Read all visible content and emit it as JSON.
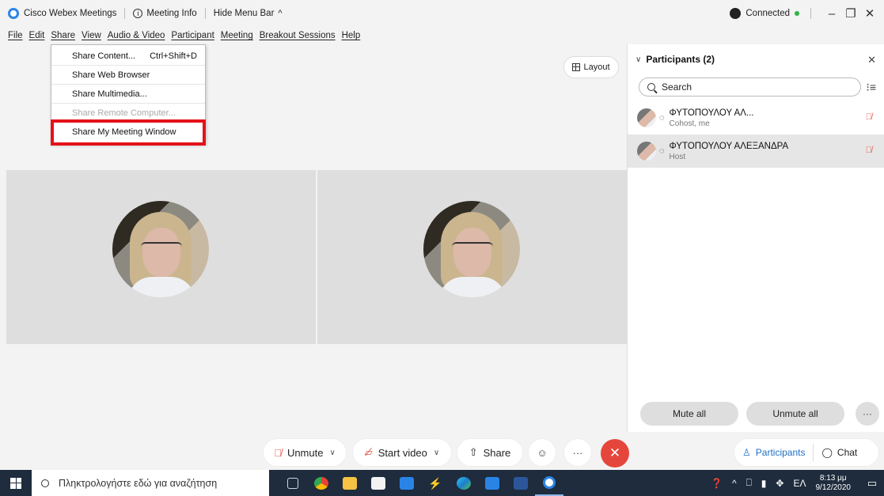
{
  "titlebar": {
    "app_name": "Cisco Webex Meetings",
    "meeting_info": "Meeting Info",
    "hide_menu": "Hide Menu Bar",
    "connection_status": "Connected"
  },
  "menubar": {
    "items": [
      "File",
      "Edit",
      "Share",
      "View",
      "Audio & Video",
      "Participant",
      "Meeting",
      "Breakout Sessions",
      "Help"
    ]
  },
  "share_menu": {
    "items": [
      {
        "label": "Share Content...",
        "shortcut": "Ctrl+Shift+D",
        "enabled": true
      },
      {
        "label": "Share Web Browser",
        "shortcut": "",
        "enabled": true
      },
      {
        "label": "Share Multimedia...",
        "shortcut": "",
        "enabled": true
      },
      {
        "label": "Share Remote Computer...",
        "shortcut": "",
        "enabled": false
      },
      {
        "label": "Share My Meeting Window",
        "shortcut": "",
        "enabled": true
      }
    ],
    "highlight_color": "#e51219"
  },
  "main": {
    "layout_label": "Layout"
  },
  "participants_panel": {
    "title": "Participants (2)",
    "search_placeholder": "Search",
    "participants": [
      {
        "name": "ΦΥΤΟΠΟΥΛΟΥ ΑΛ...",
        "role": "Cohost, me"
      },
      {
        "name": "ΦΥΤΟΠΟΥΛΟΥ ΑΛΕΞΑΝΔΡΑ",
        "role": "Host"
      }
    ],
    "mute_all": "Mute all",
    "unmute_all": "Unmute all",
    "more": "···"
  },
  "controls": {
    "unmute": "Unmute",
    "start_video": "Start video",
    "share": "Share",
    "more": "···",
    "participants_tab": "Participants",
    "chat_tab": "Chat"
  },
  "taskbar": {
    "search_placeholder": "Πληκτρολογήστε εδώ για αναζήτηση",
    "language": "ΕΛ",
    "time": "8:13 μμ",
    "date": "9/12/2020"
  },
  "colors": {
    "accent": "#1f6fc4",
    "end_call": "#e5463c",
    "mic_muted": "#e5564a",
    "taskbar": "#1e2c3d"
  }
}
